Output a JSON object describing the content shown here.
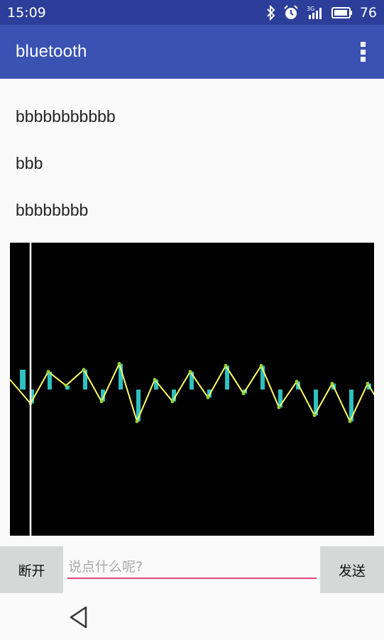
{
  "status_bar": {
    "time": "15:09",
    "network_label": "3G",
    "battery_level": "76",
    "icons": [
      "bluetooth-icon",
      "alarm-icon",
      "signal-icon",
      "battery-icon"
    ]
  },
  "app_bar": {
    "title": "bluetooth",
    "menu_icon": "overflow-menu-icon"
  },
  "messages": [
    {
      "text": "bbbbbbbbbbb"
    },
    {
      "text": "bbb"
    },
    {
      "text": "bbbbbbbb"
    }
  ],
  "chart_data": {
    "type": "line",
    "background": "#000000",
    "line_color": "#ffff66",
    "bar_color": "#2dc1c2",
    "cursor_color": "#ffffff",
    "x": [
      0,
      1,
      2,
      3,
      4,
      5,
      6,
      7,
      8,
      9,
      10,
      11,
      12,
      13,
      14,
      15,
      16,
      17,
      18,
      19,
      20
    ],
    "values": [
      -0.7,
      0.9,
      0.2,
      1.0,
      -0.6,
      1.3,
      -1.6,
      0.5,
      -0.6,
      0.9,
      -0.4,
      1.2,
      -0.2,
      1.2,
      -0.9,
      0.4,
      -1.3,
      0.3,
      -1.6,
      0.3,
      -1.2
    ],
    "leading_value": 1.0,
    "cursor_x": 0
  },
  "input_bar": {
    "disconnect_label": "断开",
    "placeholder": "说点什么呢?",
    "value": "",
    "send_label": "发送"
  },
  "nav_bar": {
    "back_icon": "back-triangle-icon"
  }
}
